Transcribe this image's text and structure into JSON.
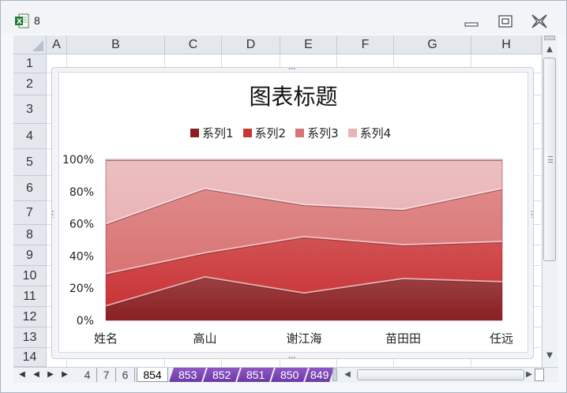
{
  "window": {
    "title": "8"
  },
  "columns": [
    "A",
    "B",
    "C",
    "D",
    "E",
    "F",
    "G",
    "H"
  ],
  "rows": [
    "1",
    "2",
    "3",
    "4",
    "5",
    "6",
    "7",
    "8",
    "9",
    "10",
    "11",
    "12",
    "13",
    "14"
  ],
  "chart_data": {
    "type": "area",
    "stacked": "percent",
    "title": "图表标题",
    "categories": [
      "姓名",
      "高山",
      "谢江海",
      "苗田田",
      "任远"
    ],
    "yticks": [
      "0%",
      "20%",
      "40%",
      "60%",
      "80%",
      "100%"
    ],
    "ylim": [
      0,
      100
    ],
    "legend_position": "top",
    "series": [
      {
        "name": "系列1",
        "cumulative_percent": [
          9,
          27,
          17,
          26,
          24
        ],
        "color": "#8a1f22"
      },
      {
        "name": "系列2",
        "cumulative_percent": [
          29,
          42,
          52,
          47,
          49
        ],
        "color": "#c93436"
      },
      {
        "name": "系列3",
        "cumulative_percent": [
          60,
          82,
          72,
          69,
          82
        ],
        "color": "#d97474"
      },
      {
        "name": "系列4",
        "cumulative_percent": [
          100,
          100,
          100,
          100,
          100
        ],
        "color": "#e9b4b6"
      }
    ]
  },
  "sheet_tabs": {
    "nav_first": "◀",
    "nav_prev": "◀",
    "nav_next": "▶",
    "nav_last": "▶",
    "plain": [
      "4",
      "7",
      "6"
    ],
    "active": "854",
    "colored": [
      "853",
      "852",
      "851",
      "850",
      "849"
    ]
  },
  "scroll": {
    "up": "▲",
    "down": "▼",
    "left": "◀",
    "right": "▶"
  }
}
